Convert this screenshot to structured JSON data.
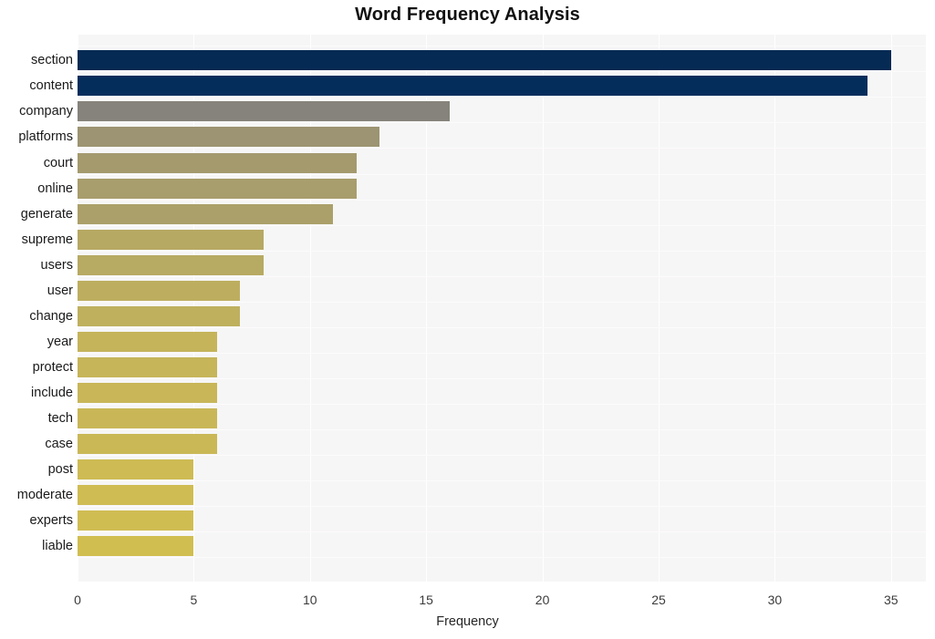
{
  "chart_data": {
    "type": "bar",
    "orientation": "horizontal",
    "title": "Word Frequency Analysis",
    "xlabel": "Frequency",
    "ylabel": "",
    "xlim": [
      0,
      36.5
    ],
    "xticks": [
      0,
      5,
      10,
      15,
      20,
      25,
      30,
      35
    ],
    "xtick_labels": [
      "0",
      "5",
      "10",
      "15",
      "20",
      "25",
      "30",
      "35"
    ],
    "grid": true,
    "legend": false,
    "categories": [
      "section",
      "content",
      "company",
      "platforms",
      "court",
      "online",
      "generate",
      "supreme",
      "users",
      "user",
      "change",
      "year",
      "protect",
      "include",
      "tech",
      "case",
      "post",
      "moderate",
      "experts",
      "liable"
    ],
    "values": [
      35,
      34,
      16,
      13,
      12,
      12,
      11,
      8,
      8,
      7,
      7,
      6,
      6,
      6,
      6,
      6,
      5,
      5,
      5,
      5
    ],
    "bar_colors": [
      "#052a53",
      "#052d5c",
      "#85837b",
      "#9c9472",
      "#a49a6e",
      "#a89d6c",
      "#aba069",
      "#b6a963",
      "#b7aa62",
      "#bdae5f",
      "#bfb05e",
      "#c5b45a",
      "#c6b559",
      "#c8b658",
      "#c9b757",
      "#cab857",
      "#cebb54",
      "#cfbc53",
      "#d0bd52",
      "#d1be51"
    ],
    "plot_background": "#f6f6f7",
    "grid_color": "#ffffff"
  }
}
